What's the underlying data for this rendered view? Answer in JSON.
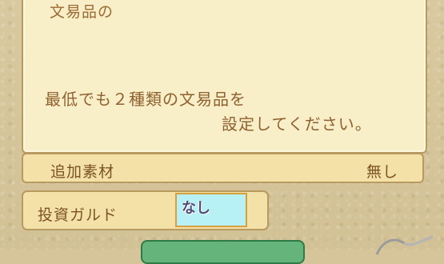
{
  "panel": {
    "top_text": "文易品の",
    "message_line1": "最低でも２種類の文易品を",
    "message_line2": "設定してください。"
  },
  "materials": {
    "label": "追加素材",
    "value": "無し"
  },
  "guild": {
    "label": "投資ガルド",
    "input_value": "なし"
  }
}
